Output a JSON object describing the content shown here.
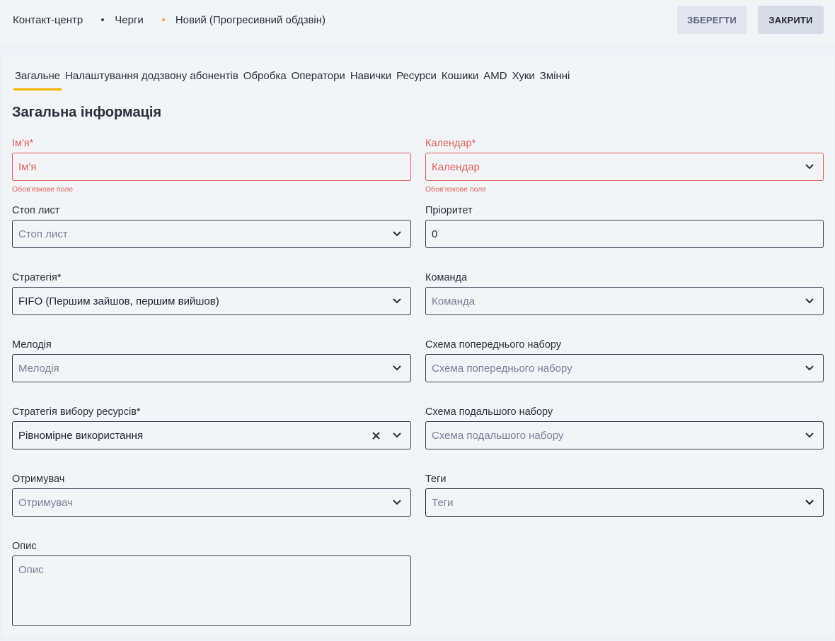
{
  "breadcrumb": {
    "items": [
      "Контакт-центр",
      "Черги",
      "Новий (Прогресивний обдзвін)"
    ]
  },
  "toolbar": {
    "save_label": "ЗБЕРЕГТИ",
    "close_label": "ЗАКРИТИ"
  },
  "tabs": [
    {
      "label": "Загальне",
      "active": true
    },
    {
      "label": "Налаштування додзвону абонентів"
    },
    {
      "label": "Обробка"
    },
    {
      "label": "Оператори"
    },
    {
      "label": "Навички"
    },
    {
      "label": "Ресурси"
    },
    {
      "label": "Кошики"
    },
    {
      "label": "AMD"
    },
    {
      "label": "Хуки"
    },
    {
      "label": "Змінні"
    }
  ],
  "section_title": "Загальна інформація",
  "form": {
    "name": {
      "label": "Ім'я*",
      "placeholder": "Ім'я",
      "error": "Обов'язкове поле"
    },
    "calendar": {
      "label": "Календар*",
      "placeholder": "Календар",
      "error": "Обов'язкове поле"
    },
    "stop_list": {
      "label": "Стоп лист",
      "placeholder": "Стоп лист"
    },
    "priority": {
      "label": "Пріоритет",
      "value": "0"
    },
    "strategy": {
      "label": "Стратегія*",
      "value": "FIFO (Першим зайшов, першим вийшов)"
    },
    "team": {
      "label": "Команда",
      "placeholder": "Команда"
    },
    "melody": {
      "label": "Мелодія",
      "placeholder": "Мелодія"
    },
    "pre_dial_scheme": {
      "label": "Схема попереднього набору",
      "placeholder": "Схема попереднього набору"
    },
    "resource_strategy": {
      "label": "Стратегія вибору ресурсів*",
      "value": "Рівномірне використання"
    },
    "post_dial_scheme": {
      "label": "Схема подальшого набору",
      "placeholder": "Схема подальшого набору"
    },
    "recipient": {
      "label": "Отримувач",
      "placeholder": "Отримувач"
    },
    "tags": {
      "label": "Теги",
      "placeholder": "Теги"
    },
    "description": {
      "label": "Опис",
      "placeholder": "Опис"
    }
  },
  "colors": {
    "accent": "#f5b200",
    "error": "#e0605a",
    "border": "#3a3f55",
    "background": "#f3f4f8"
  },
  "icons": [
    "chevron-down-icon",
    "clear-icon"
  ]
}
